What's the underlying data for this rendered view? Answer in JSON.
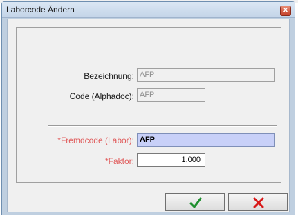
{
  "window": {
    "title": "Laborcode Ändern",
    "close_glyph": "x"
  },
  "form": {
    "bezeichnung": {
      "label": "Bezeichnung:",
      "value": "AFP"
    },
    "code": {
      "label": "Code (Alphadoc):",
      "value": "AFP"
    },
    "fremdcode": {
      "label": "*Fremdcode (Labor):",
      "value": "AFP"
    },
    "faktor": {
      "label": "*Faktor:",
      "value": "1,000"
    }
  },
  "buttons": {
    "ok_icon": "checkmark-icon",
    "cancel_icon": "red-x-icon"
  },
  "colors": {
    "required_label": "#e05a5a",
    "active_field": "#c8d0f8",
    "ok": "#1f8f2f",
    "cancel": "#d81818"
  }
}
